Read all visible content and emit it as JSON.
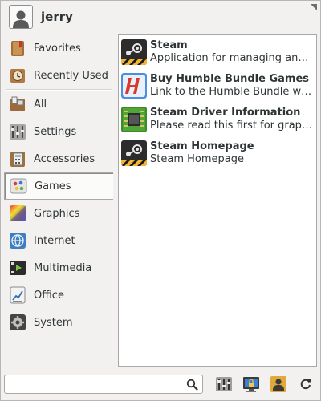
{
  "user": {
    "name": "jerry"
  },
  "categories": [
    {
      "label": "Favorites",
      "icon": "favorites-icon"
    },
    {
      "label": "Recently Used",
      "icon": "recently-used-icon"
    },
    {
      "label": "All",
      "icon": "all-applications-icon"
    },
    {
      "label": "Settings",
      "icon": "settings-icon"
    },
    {
      "label": "Accessories",
      "icon": "accessories-icon"
    },
    {
      "label": "Games",
      "icon": "games-icon",
      "selected": true
    },
    {
      "label": "Graphics",
      "icon": "graphics-icon"
    },
    {
      "label": "Internet",
      "icon": "internet-icon"
    },
    {
      "label": "Multimedia",
      "icon": "multimedia-icon"
    },
    {
      "label": "Office",
      "icon": "office-icon"
    },
    {
      "label": "System",
      "icon": "system-icon"
    }
  ],
  "apps": [
    {
      "name": "Steam",
      "desc": "Application for managing and pla...",
      "icon": "steam-icon"
    },
    {
      "name": "Buy Humble Bundle Games",
      "desc": "Link to the Humble Bundle website",
      "icon": "humble-bundle-icon"
    },
    {
      "name": "Steam Driver Information",
      "desc": "Please read this first for graphics ...",
      "icon": "steam-driver-icon"
    },
    {
      "name": "Steam Homepage",
      "desc": "Steam Homepage",
      "icon": "steam-homepage-icon"
    }
  ],
  "search": {
    "value": "",
    "placeholder": ""
  },
  "actions": [
    "settings-manager-icon",
    "lock-screen-icon",
    "switch-user-icon",
    "log-out-icon"
  ]
}
